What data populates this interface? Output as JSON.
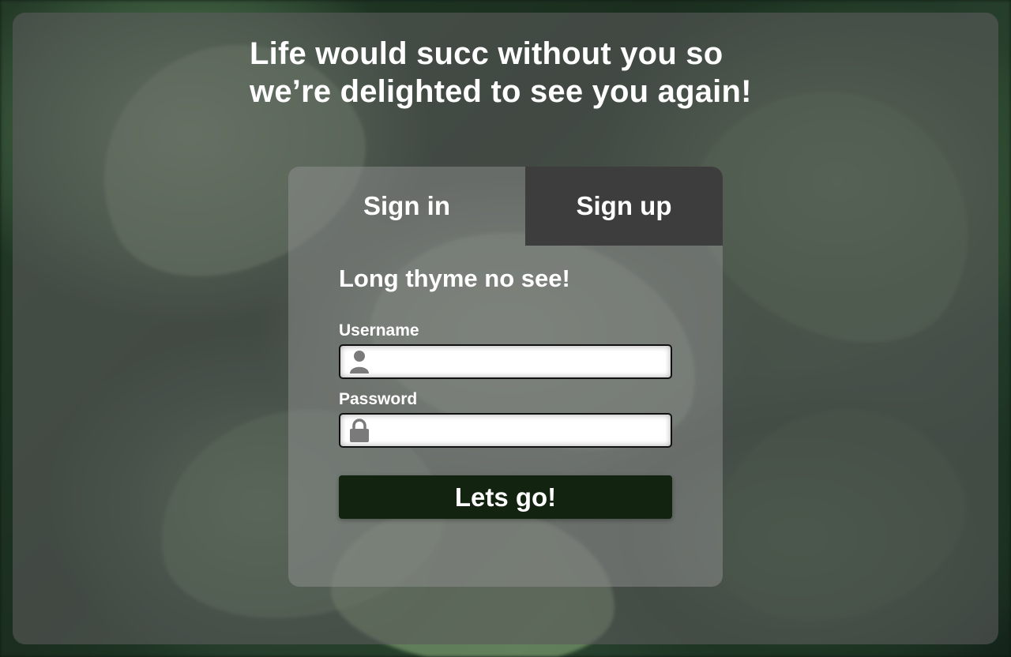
{
  "background": {
    "accent_dark": "#12230f",
    "overlay_color": "#5a5a5a"
  },
  "header": {
    "headline_line1": "Life would succ without you so",
    "headline_line2": "we’re delighted to see you again!"
  },
  "auth_card": {
    "tabs": [
      {
        "label": "Sign in",
        "active": true
      },
      {
        "label": "Sign up",
        "active": false
      }
    ],
    "title": "Long thyme no see!",
    "username": {
      "label": "Username",
      "value": "",
      "icon": "user-icon"
    },
    "password": {
      "label": "Password",
      "value": "",
      "icon": "lock-icon"
    },
    "submit_label": "Lets go!"
  }
}
